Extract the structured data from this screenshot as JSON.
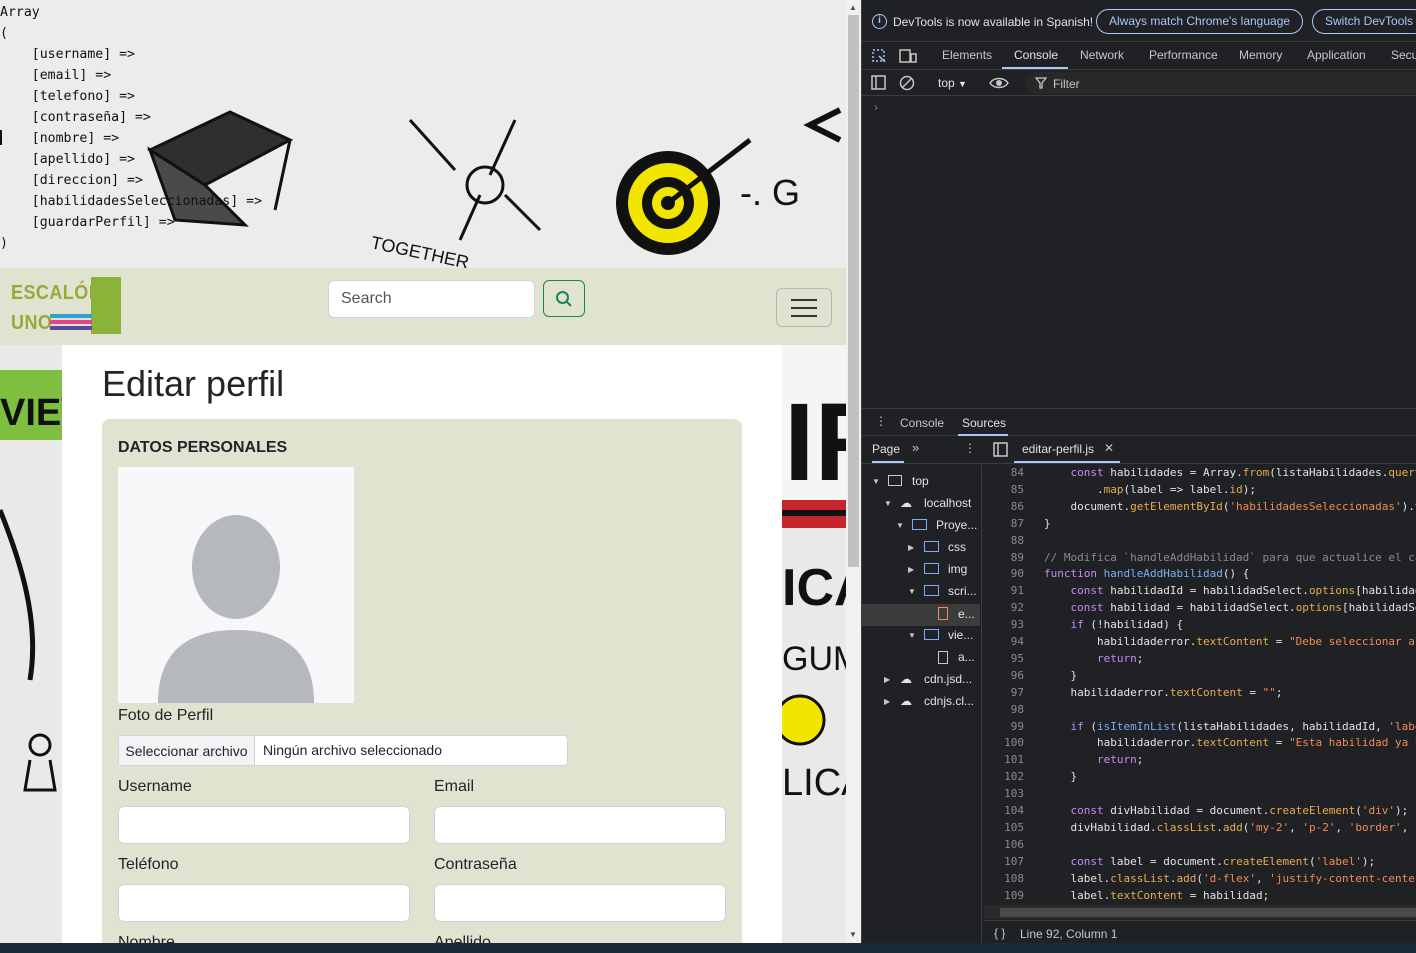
{
  "php_output": {
    "lines": [
      "Array",
      "(",
      "    [username] =>",
      "    [email] =>",
      "    [telefono] =>",
      "    [contraseña] =>",
      "    [nombre] =>",
      "    [apellido] =>",
      "    [direccion] =>",
      "    [habilidadesSeleccionadas] =>",
      "    [guardarPerfil] =>",
      ")"
    ]
  },
  "background_words": {
    "together": "TOGETHER",
    "review": "VIEW",
    "g": "-. G",
    "ar": "IR",
    "ica": "ICA",
    "gume": "GUME",
    "licat": "LICAT"
  },
  "navbar": {
    "logo_line1": "ESCALÓN",
    "logo_line2": "UNO",
    "search_placeholder": "Search",
    "search_icon": "search-icon",
    "menu_icon": "hamburger-icon"
  },
  "page": {
    "title": "Editar perfil",
    "section_title": "DATOS PERSONALES",
    "photo_label": "Foto de Perfil",
    "file_button": "Seleccionar archivo",
    "file_status": "Ningún archivo seleccionado",
    "fields": {
      "username": {
        "label": "Username",
        "value": ""
      },
      "email": {
        "label": "Email",
        "value": ""
      },
      "telefono": {
        "label": "Teléfono",
        "value": ""
      },
      "contrasena": {
        "label": "Contraseña",
        "value": ""
      },
      "nombre": {
        "label": "Nombre"
      },
      "apellido": {
        "label": "Apellido"
      }
    }
  },
  "devtools": {
    "info_text": "DevTools is now available in Spanish!",
    "btn_match": "Always match Chrome's language",
    "btn_switch": "Switch DevTools",
    "tabs": [
      "Elements",
      "Console",
      "Network",
      "Performance",
      "Memory",
      "Application",
      "Secu"
    ],
    "active_tab": "Console",
    "context": "top",
    "filter_placeholder": "Filter",
    "prompt": "›",
    "drawer_tabs": [
      "Console",
      "Sources"
    ],
    "page_tab": "Page",
    "file_tab": "editar-perfil.js",
    "tree": [
      "top",
      "localhost",
      "Proye...",
      "css",
      "img",
      "scri...",
      "e...",
      "vie...",
      "a...",
      "cdn.jsd...",
      "cdnjs.cl..."
    ],
    "status": "Line 92, Column 1",
    "line_numbers": [
      "84",
      "85",
      "86",
      "87",
      "88",
      "89",
      "90",
      "91",
      "92",
      "93",
      "94",
      "95",
      "96",
      "97",
      "98",
      "99",
      "100",
      "101",
      "102",
      "103",
      "104",
      "105",
      "106",
      "107",
      "108",
      "109"
    ],
    "code_lines": [
      "    const habilidades = Array.from(listaHabilidades.query",
      "        .map(label => label.id);",
      "    document.getElementById('habilidadesSeleccionadas').v",
      "}",
      "",
      "// Modifica `handleAddHabilidad` para que actualice el ca",
      "function handleAddHabilidad() {",
      "    const habilidadId = habilidadSelect.options[habilidad",
      "    const habilidad = habilidadSelect.options[habilidadSe",
      "    if (!habilidad) {",
      "        habilidaderror.textContent = \"Debe seleccionar al",
      "        return;",
      "    }",
      "    habilidaderror.textContent = \"\";",
      "",
      "    if (isItemInList(listaHabilidades, habilidadId, 'labe",
      "        habilidaderror.textContent = \"Esta habilidad ya h",
      "        return;",
      "    }",
      "",
      "    const divHabilidad = document.createElement('div');",
      "    divHabilidad.classList.add('my-2', 'p-2', 'border',",
      "",
      "    const label = document.createElement('label');",
      "    label.classList.add('d-flex', 'justify-content-center",
      "    label.textContent = habilidad;"
    ]
  }
}
